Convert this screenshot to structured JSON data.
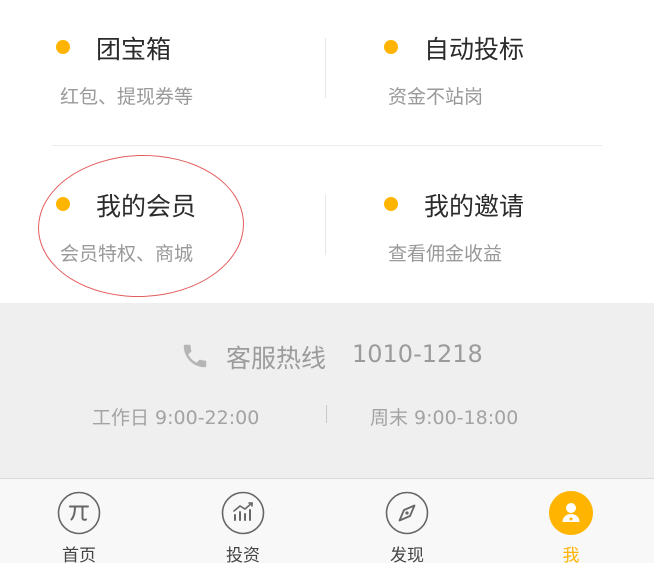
{
  "menu": {
    "items": [
      {
        "title": "团宝箱",
        "subtitle": "红包、提现券等"
      },
      {
        "title": "自动投标",
        "subtitle": "资金不站岗"
      },
      {
        "title": "我的会员",
        "subtitle": "会员特权、商城"
      },
      {
        "title": "我的邀请",
        "subtitle": "查看佣金收益"
      }
    ],
    "dot_color": "#ffb400",
    "highlight_color": "#e35d5d"
  },
  "service": {
    "hotline_label": "客服热线",
    "hotline_number": "1010-1218",
    "weekday_hours": "工作日 9:00-22:00",
    "weekend_hours": "周末 9:00-18:00",
    "icon": "phone-icon"
  },
  "tabbar": {
    "tabs": [
      {
        "label": "首页",
        "icon": "pi-icon"
      },
      {
        "label": "投资",
        "icon": "chart-icon"
      },
      {
        "label": "发现",
        "icon": "compass-icon"
      },
      {
        "label": "我",
        "icon": "user-icon"
      }
    ],
    "active_index": 3,
    "active_color": "#ffb400"
  }
}
